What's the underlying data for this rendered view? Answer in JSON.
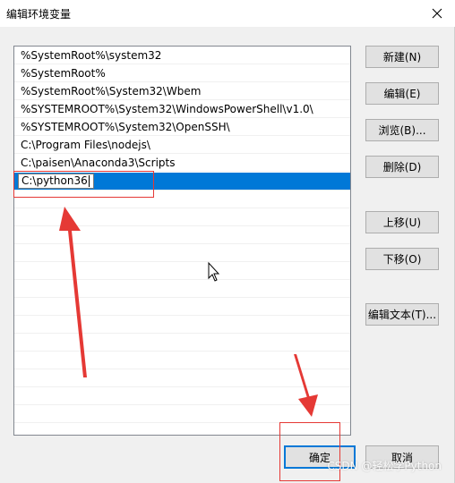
{
  "window": {
    "title": "编辑环境变量"
  },
  "paths": [
    "%SystemRoot%\\system32",
    "%SystemRoot%",
    "%SystemRoot%\\System32\\Wbem",
    "%SYSTEMROOT%\\System32\\WindowsPowerShell\\v1.0\\",
    "%SYSTEMROOT%\\System32\\OpenSSH\\",
    "C:\\Program Files\\nodejs\\",
    "C:\\paisen\\Anaconda3\\Scripts"
  ],
  "editing_value": "C:\\python36",
  "buttons": {
    "new": "新建(N)",
    "edit": "编辑(E)",
    "browse": "浏览(B)...",
    "delete": "删除(D)",
    "move_up": "上移(U)",
    "move_down": "下移(O)",
    "edit_text": "编辑文本(T)...",
    "ok": "确定",
    "cancel": "取消"
  },
  "watermark": "CSDN @轻松学Python",
  "colors": {
    "selection": "#0078d7",
    "annotation": "#e53935"
  }
}
